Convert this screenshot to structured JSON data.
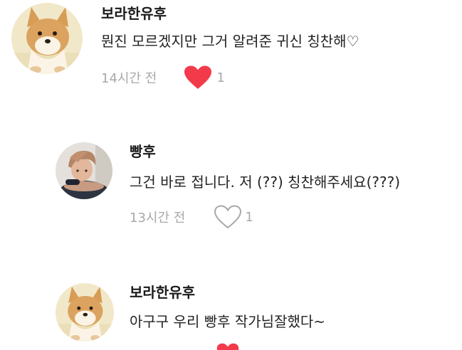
{
  "comments": [
    {
      "author": "보라한유후",
      "text": "뭔진 모르겠지만 그거 알려준 귀신 칭찬해♡",
      "time": "14시간 전",
      "likes": "1",
      "liked": true,
      "avatar": "shiba-dog-avatar"
    },
    {
      "author": "빵후",
      "text": "그건 바로 접니다. 저 (??) 칭찬해주세요(???)",
      "time": "13시간 전",
      "likes": "1",
      "liked": false,
      "avatar": "person-photo-avatar"
    },
    {
      "author": "보라한유후",
      "text": "아구구 우리 빵후 작가님잘했다~",
      "avatar": "shiba-dog-avatar"
    }
  ],
  "colors": {
    "liked_heart": "#f23a4a",
    "muted_text": "#a8a8a8",
    "author_text": "#1a1a1a",
    "body_text": "#222222"
  },
  "icons": [
    "heart-filled-icon",
    "heart-outline-icon"
  ]
}
